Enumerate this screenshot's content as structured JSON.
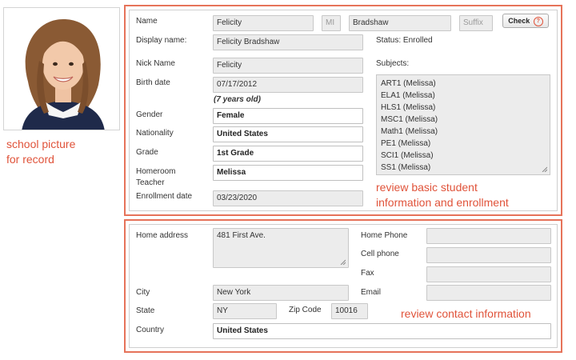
{
  "annotations": {
    "photo_note_line1": "school picture",
    "photo_note_line2": "for record",
    "basic_note_line1": "review basic student",
    "basic_note_line2": "information and enrollment",
    "contact_note": "review contact information"
  },
  "student": {
    "name_label": "Name",
    "first_name": "Felicity",
    "middle_initial_placeholder": "MI",
    "last_name": "Bradshaw",
    "suffix_placeholder": "Suffix",
    "check_button_label": "Check",
    "display_name_label": "Display name:",
    "display_name": "Felicity Bradshaw",
    "status_text": "Status: Enrolled",
    "nick_name_label": "Nick Name",
    "nick_name": "Felicity",
    "subjects_label": "Subjects:",
    "subjects": [
      "ART1 (Melissa)",
      "ELA1 (Melissa)",
      "HLS1 (Melissa)",
      "MSC1 (Melissa)",
      "Math1 (Melissa)",
      "PE1 (Melissa)",
      "SCI1 (Melissa)",
      "SS1 (Melissa)"
    ],
    "birth_date_label": "Birth date",
    "birth_date": "07/17/2012",
    "age_text": "(7 years old)",
    "gender_label": "Gender",
    "gender": "Female",
    "nationality_label": "Nationality",
    "nationality": "United States",
    "grade_label": "Grade",
    "grade": "1st Grade",
    "homeroom_label_line1": "Homeroom",
    "homeroom_label_line2": "Teacher",
    "homeroom_teacher": "Melissa",
    "enrollment_date_label": "Enrollment date",
    "enrollment_date": "03/23/2020"
  },
  "contact": {
    "home_address_label": "Home address",
    "home_address": "481 First Ave.",
    "home_phone_label": "Home Phone",
    "cell_phone_label": "Cell phone",
    "fax_label": "Fax",
    "email_label": "Email",
    "city_label": "City",
    "city": "New York",
    "state_label": "State",
    "state": "NY",
    "zip_label": "Zip Code",
    "zip": "10016",
    "country_label": "Country",
    "country": "United States"
  },
  "colors": {
    "annotation_red": "#e0533a",
    "highlight_border": "#e6735a",
    "readonly_field": "#ececec"
  },
  "icons": {
    "check_button_icon": "info-circle-icon",
    "resize_handle": "resize-handle-icon"
  }
}
